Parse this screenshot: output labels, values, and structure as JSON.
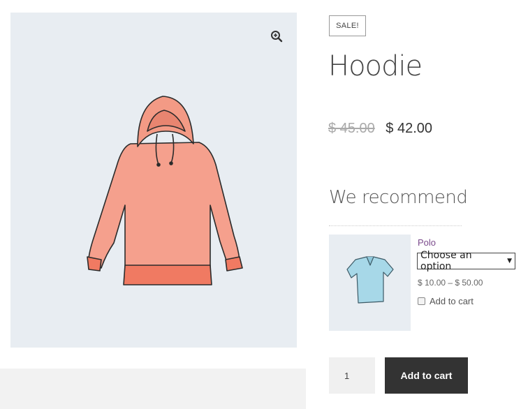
{
  "product": {
    "badge": "SALE!",
    "title": "Hoodie",
    "price_old": "$ 45.00",
    "price_new": "$ 42.00",
    "image_icon": "hoodie-illustration",
    "zoom_icon": "magnify-plus-icon"
  },
  "recommend": {
    "heading": "We recommend",
    "items": [
      {
        "name": "Polo",
        "select_value": "Choose an option",
        "price_range": "$ 10.00 – $ 50.00",
        "add_label": "Add to cart",
        "image_icon": "polo-shirt-illustration"
      }
    ]
  },
  "cart": {
    "quantity": "1",
    "button_label": "Add to cart"
  },
  "colors": {
    "gallery_bg": "#e8edf2",
    "hoodie": "#f28b76",
    "polo": "#9fd3e3",
    "button_bg": "#333333",
    "link": "#7b4b8c"
  }
}
